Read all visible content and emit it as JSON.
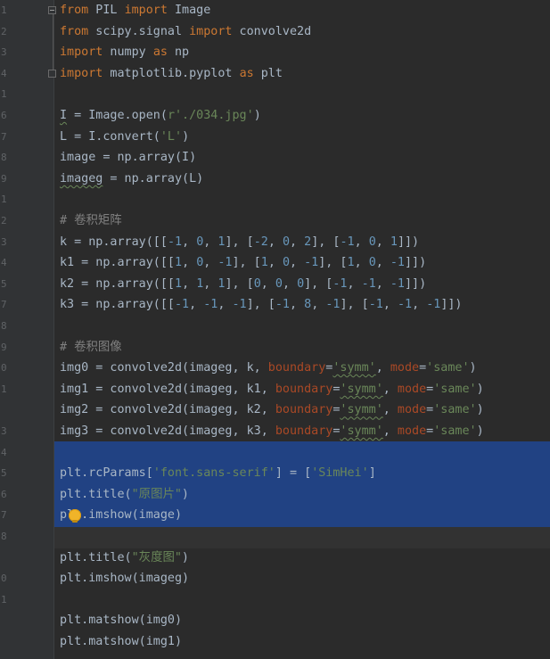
{
  "gutter": {
    "line_numbers": [
      "1",
      "2",
      "3",
      "4",
      "1",
      "6",
      "7",
      "8",
      "9",
      "1",
      "2",
      "3",
      "4",
      "5",
      "7",
      "8",
      "9",
      "0",
      "1",
      "",
      "3",
      "4",
      "5",
      "6",
      "7",
      "8",
      "",
      "0",
      "1"
    ]
  },
  "code": [
    [
      {
        "t": "kw",
        "v": "from"
      },
      {
        "t": "p",
        "v": " PIL "
      },
      {
        "t": "kw",
        "v": "import"
      },
      {
        "t": "p",
        "v": " Image"
      }
    ],
    [
      {
        "t": "kw",
        "v": "from"
      },
      {
        "t": "p",
        "v": " scipy.signal "
      },
      {
        "t": "kw",
        "v": "import"
      },
      {
        "t": "p",
        "v": " convolve2d"
      }
    ],
    [
      {
        "t": "kw",
        "v": "import"
      },
      {
        "t": "p",
        "v": " numpy "
      },
      {
        "t": "kw",
        "v": "as"
      },
      {
        "t": "p",
        "v": " np"
      }
    ],
    [
      {
        "t": "kw",
        "v": "import"
      },
      {
        "t": "p",
        "v": " matplotlib.pyplot "
      },
      {
        "t": "kw",
        "v": "as"
      },
      {
        "t": "p",
        "v": " plt"
      }
    ],
    [],
    [
      {
        "t": "p",
        "v": "I = Image.open("
      },
      {
        "t": "str",
        "v": "r'./034.jpg'"
      },
      {
        "t": "p",
        "v": ")"
      }
    ],
    [
      {
        "t": "p",
        "v": "L = I.convert("
      },
      {
        "t": "str",
        "v": "'L'"
      },
      {
        "t": "p",
        "v": ")"
      }
    ],
    [
      {
        "t": "p",
        "v": "image = np.array(I)"
      }
    ],
    [
      {
        "t": "p",
        "v": "imageg = np.array(L)"
      }
    ],
    [],
    [
      {
        "t": "cmt",
        "v": "# 卷积矩阵"
      }
    ],
    [
      {
        "t": "p",
        "v": "k = np.array([["
      },
      {
        "t": "num",
        "v": "-1"
      },
      {
        "t": "p",
        "v": ", "
      },
      {
        "t": "num",
        "v": "0"
      },
      {
        "t": "p",
        "v": ", "
      },
      {
        "t": "num",
        "v": "1"
      },
      {
        "t": "p",
        "v": "], ["
      },
      {
        "t": "num",
        "v": "-2"
      },
      {
        "t": "p",
        "v": ", "
      },
      {
        "t": "num",
        "v": "0"
      },
      {
        "t": "p",
        "v": ", "
      },
      {
        "t": "num",
        "v": "2"
      },
      {
        "t": "p",
        "v": "], ["
      },
      {
        "t": "num",
        "v": "-1"
      },
      {
        "t": "p",
        "v": ", "
      },
      {
        "t": "num",
        "v": "0"
      },
      {
        "t": "p",
        "v": ", "
      },
      {
        "t": "num",
        "v": "1"
      },
      {
        "t": "p",
        "v": "]])"
      }
    ],
    [
      {
        "t": "p",
        "v": "k1 = np.array([["
      },
      {
        "t": "num",
        "v": "1"
      },
      {
        "t": "p",
        "v": ", "
      },
      {
        "t": "num",
        "v": "0"
      },
      {
        "t": "p",
        "v": ", "
      },
      {
        "t": "num",
        "v": "-1"
      },
      {
        "t": "p",
        "v": "], ["
      },
      {
        "t": "num",
        "v": "1"
      },
      {
        "t": "p",
        "v": ", "
      },
      {
        "t": "num",
        "v": "0"
      },
      {
        "t": "p",
        "v": ", "
      },
      {
        "t": "num",
        "v": "-1"
      },
      {
        "t": "p",
        "v": "], ["
      },
      {
        "t": "num",
        "v": "1"
      },
      {
        "t": "p",
        "v": ", "
      },
      {
        "t": "num",
        "v": "0"
      },
      {
        "t": "p",
        "v": ", "
      },
      {
        "t": "num",
        "v": "-1"
      },
      {
        "t": "p",
        "v": "]])"
      }
    ],
    [
      {
        "t": "p",
        "v": "k2 = np.array([["
      },
      {
        "t": "num",
        "v": "1"
      },
      {
        "t": "p",
        "v": ", "
      },
      {
        "t": "num",
        "v": "1"
      },
      {
        "t": "p",
        "v": ", "
      },
      {
        "t": "num",
        "v": "1"
      },
      {
        "t": "p",
        "v": "], ["
      },
      {
        "t": "num",
        "v": "0"
      },
      {
        "t": "p",
        "v": ", "
      },
      {
        "t": "num",
        "v": "0"
      },
      {
        "t": "p",
        "v": ", "
      },
      {
        "t": "num",
        "v": "0"
      },
      {
        "t": "p",
        "v": "], ["
      },
      {
        "t": "num",
        "v": "-1"
      },
      {
        "t": "p",
        "v": ", "
      },
      {
        "t": "num",
        "v": "-1"
      },
      {
        "t": "p",
        "v": ", "
      },
      {
        "t": "num",
        "v": "-1"
      },
      {
        "t": "p",
        "v": "]])"
      }
    ],
    [
      {
        "t": "p",
        "v": "k3 = np.array([["
      },
      {
        "t": "num",
        "v": "-1"
      },
      {
        "t": "p",
        "v": ", "
      },
      {
        "t": "num",
        "v": "-1"
      },
      {
        "t": "p",
        "v": ", "
      },
      {
        "t": "num",
        "v": "-1"
      },
      {
        "t": "p",
        "v": "], ["
      },
      {
        "t": "num",
        "v": "-1"
      },
      {
        "t": "p",
        "v": ", "
      },
      {
        "t": "num",
        "v": "8"
      },
      {
        "t": "p",
        "v": ", "
      },
      {
        "t": "num",
        "v": "-1"
      },
      {
        "t": "p",
        "v": "], ["
      },
      {
        "t": "num",
        "v": "-1"
      },
      {
        "t": "p",
        "v": ", "
      },
      {
        "t": "num",
        "v": "-1"
      },
      {
        "t": "p",
        "v": ", "
      },
      {
        "t": "num",
        "v": "-1"
      },
      {
        "t": "p",
        "v": "]])"
      }
    ],
    [],
    [
      {
        "t": "cmt",
        "v": "# 卷积图像"
      }
    ],
    [
      {
        "t": "p",
        "v": "img0 = convolve2d(imageg, k, "
      },
      {
        "t": "param",
        "v": "boundary"
      },
      {
        "t": "p",
        "v": "="
      },
      {
        "t": "str",
        "v": "'symm'"
      },
      {
        "t": "p",
        "v": ", "
      },
      {
        "t": "param",
        "v": "mode"
      },
      {
        "t": "p",
        "v": "="
      },
      {
        "t": "str",
        "v": "'same'"
      },
      {
        "t": "p",
        "v": ")"
      }
    ],
    [
      {
        "t": "p",
        "v": "img1 = convolve2d(imageg, k1, "
      },
      {
        "t": "param",
        "v": "boundary"
      },
      {
        "t": "p",
        "v": "="
      },
      {
        "t": "str",
        "v": "'symm'"
      },
      {
        "t": "p",
        "v": ", "
      },
      {
        "t": "param",
        "v": "mode"
      },
      {
        "t": "p",
        "v": "="
      },
      {
        "t": "str",
        "v": "'same'"
      },
      {
        "t": "p",
        "v": ")"
      }
    ],
    [
      {
        "t": "p",
        "v": "img2 = convolve2d(imageg, k2, "
      },
      {
        "t": "param",
        "v": "boundary"
      },
      {
        "t": "p",
        "v": "="
      },
      {
        "t": "str",
        "v": "'symm'"
      },
      {
        "t": "p",
        "v": ", "
      },
      {
        "t": "param",
        "v": "mode"
      },
      {
        "t": "p",
        "v": "="
      },
      {
        "t": "str",
        "v": "'same'"
      },
      {
        "t": "p",
        "v": ")"
      }
    ],
    [
      {
        "t": "p",
        "v": "img3 = convolve2d(imageg, k3, "
      },
      {
        "t": "param",
        "v": "boundary"
      },
      {
        "t": "p",
        "v": "="
      },
      {
        "t": "str",
        "v": "'symm'"
      },
      {
        "t": "p",
        "v": ", "
      },
      {
        "t": "param",
        "v": "mode"
      },
      {
        "t": "p",
        "v": "="
      },
      {
        "t": "str",
        "v": "'same'"
      },
      {
        "t": "p",
        "v": ")"
      }
    ],
    [],
    [
      {
        "t": "p",
        "v": "plt.rcParams["
      },
      {
        "t": "str",
        "v": "'font.sans-serif'"
      },
      {
        "t": "p",
        "v": "] = ["
      },
      {
        "t": "str",
        "v": "'SimHei'"
      },
      {
        "t": "p",
        "v": "]"
      }
    ],
    [
      {
        "t": "p",
        "v": "plt.title("
      },
      {
        "t": "str",
        "v": "\"原图片\""
      },
      {
        "t": "p",
        "v": ")"
      }
    ],
    [
      {
        "t": "p",
        "v": "plt.imshow(image)"
      }
    ],
    [],
    [
      {
        "t": "p",
        "v": "plt.title("
      },
      {
        "t": "str",
        "v": "\"灰度图\""
      },
      {
        "t": "p",
        "v": ")"
      }
    ],
    [
      {
        "t": "p",
        "v": "plt.imshow(imageg)"
      }
    ],
    [],
    [
      {
        "t": "p",
        "v": "plt.matshow(img0)"
      }
    ],
    [
      {
        "t": "p",
        "v": "plt.matshow(img1)"
      }
    ]
  ],
  "colors": {
    "background": "#2b2b2b",
    "keyword": "#cc7832",
    "string": "#6a8759",
    "number": "#6897bb",
    "comment": "#808080",
    "parameter": "#aa4926",
    "selection": "#214283"
  },
  "icons": [
    "lightbulb-icon",
    "fold-icon"
  ]
}
